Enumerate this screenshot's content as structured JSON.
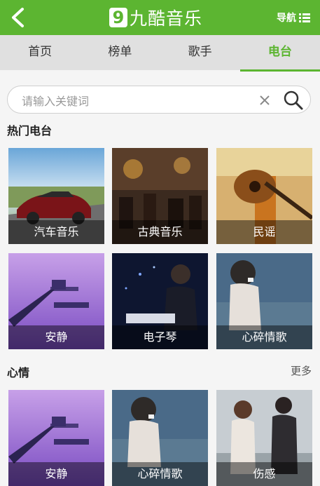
{
  "header": {
    "logo_number": "9",
    "logo_text": "九酷音乐",
    "nav_label": "导航"
  },
  "tabs": [
    {
      "label": "首页"
    },
    {
      "label": "榜单"
    },
    {
      "label": "歌手"
    },
    {
      "label": "电台",
      "active": true
    }
  ],
  "search": {
    "placeholder": "请输入关键词",
    "value": ""
  },
  "hot_radio": {
    "title": "热门电台",
    "items": [
      {
        "label": "汽车音乐"
      },
      {
        "label": "古典音乐"
      },
      {
        "label": "民谣"
      },
      {
        "label": "安静"
      },
      {
        "label": "电子琴"
      },
      {
        "label": "心碎情歌"
      }
    ]
  },
  "mood": {
    "title": "心情",
    "more_label": "更多",
    "items": [
      {
        "label": "安静"
      },
      {
        "label": "心碎情歌"
      },
      {
        "label": "伤感"
      }
    ]
  },
  "colors": {
    "accent": "#5cb531",
    "tab_bar": "#e0e0e0",
    "background": "#f5f5f5"
  }
}
